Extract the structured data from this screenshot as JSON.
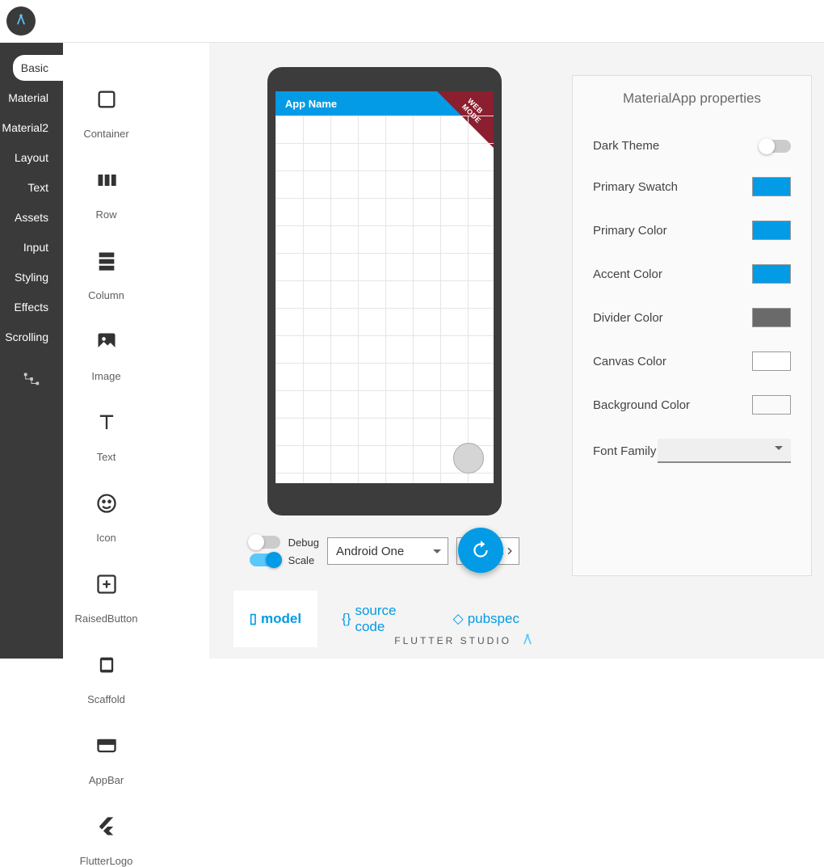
{
  "sidebar": {
    "items": [
      {
        "label": "Basic",
        "active": true
      },
      {
        "label": "Material",
        "active": false
      },
      {
        "label": "Material2",
        "active": false
      },
      {
        "label": "Layout",
        "active": false
      },
      {
        "label": "Text",
        "active": false
      },
      {
        "label": "Assets",
        "active": false
      },
      {
        "label": "Input",
        "active": false
      },
      {
        "label": "Styling",
        "active": false
      },
      {
        "label": "Effects",
        "active": false
      },
      {
        "label": "Scrolling",
        "active": false
      }
    ]
  },
  "widgets": [
    {
      "label": "Container",
      "icon": "container"
    },
    {
      "label": "Row",
      "icon": "row"
    },
    {
      "label": "Column",
      "icon": "column"
    },
    {
      "label": "Image",
      "icon": "image"
    },
    {
      "label": "Text",
      "icon": "text"
    },
    {
      "label": "Icon",
      "icon": "icon"
    },
    {
      "label": "RaisedButton",
      "icon": "raisedbutton"
    },
    {
      "label": "Scaffold",
      "icon": "scaffold"
    },
    {
      "label": "AppBar",
      "icon": "appbar"
    },
    {
      "label": "FlutterLogo",
      "icon": "flutterlogo"
    }
  ],
  "preview": {
    "app_title": "App Name",
    "badge": "WEB MODE"
  },
  "controls": {
    "debug_label": "Debug",
    "scale_label": "Scale",
    "debug_on": false,
    "scale_on": true,
    "device": "Android One"
  },
  "bottom_tabs": {
    "model": "model",
    "source": "source code",
    "pubspec": "pubspec"
  },
  "props": {
    "title": "MaterialApp properties",
    "rows": [
      {
        "label": "Dark Theme",
        "type": "toggle",
        "value": false
      },
      {
        "label": "Primary Swatch",
        "type": "swatch",
        "value": "#039be5"
      },
      {
        "label": "Primary Color",
        "type": "swatch",
        "value": "#039be5"
      },
      {
        "label": "Accent Color",
        "type": "swatch",
        "value": "#039be5"
      },
      {
        "label": "Divider Color",
        "type": "swatch",
        "value": "#6a6a6a"
      },
      {
        "label": "Canvas Color",
        "type": "swatch",
        "value": "#ffffff"
      },
      {
        "label": "Background Color",
        "type": "swatch",
        "value": "#fafafa"
      },
      {
        "label": "Font Family",
        "type": "select",
        "value": ""
      }
    ]
  },
  "brand": "FLUTTER STUDIO"
}
